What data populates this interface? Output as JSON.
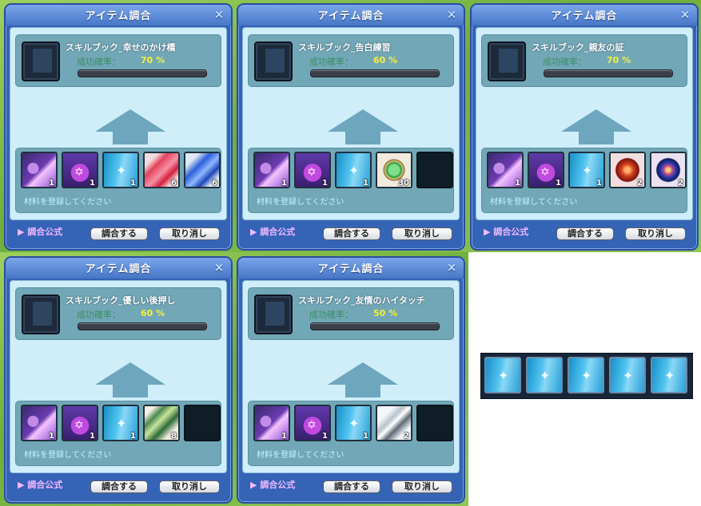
{
  "windows": [
    {
      "title": "アイテム調合",
      "close": "×",
      "result": {
        "name": "スキルブック_幸せのかけ橋",
        "rate_label": "成功確率：",
        "rate": "70 %"
      },
      "materials": [
        {
          "icon": "purple-potion-icon",
          "qty": "1"
        },
        {
          "icon": "star-vial-icon",
          "qty": "1"
        },
        {
          "icon": "skill-book-icon",
          "qty": "1"
        },
        {
          "icon": "red-gem-icon",
          "qty": "6"
        },
        {
          "icon": "blue-gem-icon",
          "qty": "6"
        }
      ],
      "register_text": "材料を登録してください",
      "formula_label": "▶ 調合公式",
      "ok_label": "調合する",
      "cancel_label": "取り消し"
    },
    {
      "title": "アイテム調合",
      "close": "×",
      "result": {
        "name": "スキルブック_告白練習",
        "rate_label": "成功確率：",
        "rate": "60 %"
      },
      "materials": [
        {
          "icon": "purple-potion-icon",
          "qty": "1"
        },
        {
          "icon": "star-vial-icon",
          "qty": "1"
        },
        {
          "icon": "skill-book-icon",
          "qty": "1"
        },
        {
          "icon": "green-orb-icon",
          "qty": "30"
        },
        {
          "icon": "empty-slot",
          "qty": ""
        }
      ],
      "register_text": "材料を登録してください",
      "formula_label": "▶ 調合公式",
      "ok_label": "調合する",
      "cancel_label": "取り消し"
    },
    {
      "title": "アイテム調合",
      "close": "×",
      "result": {
        "name": "スキルブック_親友の証",
        "rate_label": "成功確率：",
        "rate": "70 %"
      },
      "materials": [
        {
          "icon": "purple-potion-icon",
          "qty": "1"
        },
        {
          "icon": "star-vial-icon",
          "qty": "1"
        },
        {
          "icon": "skill-book-icon",
          "qty": "1"
        },
        {
          "icon": "red-orb-icon",
          "qty": "2"
        },
        {
          "icon": "blue-orb-icon",
          "qty": "2"
        }
      ],
      "register_text": "材料を登録してください",
      "formula_label": "▶ 調合公式",
      "ok_label": "調合する",
      "cancel_label": "取り消し"
    },
    {
      "title": "アイテム調合",
      "close": "×",
      "result": {
        "name": "スキルブック_優しい後押し",
        "rate_label": "成功確率：",
        "rate": "60 %"
      },
      "materials": [
        {
          "icon": "purple-potion-icon",
          "qty": "1"
        },
        {
          "icon": "star-vial-icon",
          "qty": "1"
        },
        {
          "icon": "skill-book-icon",
          "qty": "1"
        },
        {
          "icon": "green-card-icon",
          "qty": "8"
        },
        {
          "icon": "empty-slot",
          "qty": ""
        }
      ],
      "register_text": "材料を登録してください",
      "formula_label": "▶ 調合公式",
      "ok_label": "調合する",
      "cancel_label": "取り消し"
    },
    {
      "title": "アイテム調合",
      "close": "×",
      "result": {
        "name": "スキルブック_友情のハイタッチ",
        "rate_label": "成功確率：",
        "rate": "50 %"
      },
      "materials": [
        {
          "icon": "purple-potion-icon",
          "qty": "1"
        },
        {
          "icon": "star-vial-icon",
          "qty": "1"
        },
        {
          "icon": "skill-book-icon",
          "qty": "1"
        },
        {
          "icon": "silver-crystal-icon",
          "qty": "2"
        },
        {
          "icon": "empty-slot",
          "qty": ""
        }
      ],
      "register_text": "材料を登録してください",
      "formula_label": "▶ 調合公式",
      "ok_label": "調合する",
      "cancel_label": "取り消し"
    }
  ],
  "result_strip": {
    "items": [
      "skill-book-icon",
      "skill-book-icon",
      "skill-book-icon",
      "skill-book-icon",
      "skill-book-icon"
    ]
  }
}
